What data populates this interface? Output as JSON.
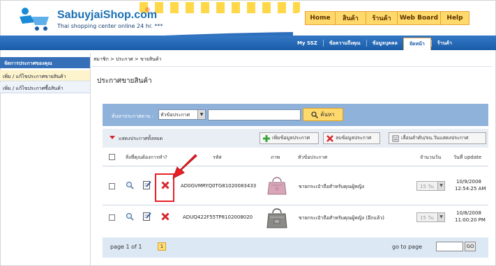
{
  "brand": {
    "name": "SabuyjaiShop.com",
    "reg": "®",
    "tagline": "Thai shopping center online 24 hr. ***"
  },
  "topnav": [
    {
      "label": "Home",
      "w": 43
    },
    {
      "label": "สินค้า",
      "w": 44
    },
    {
      "label": "ร้านค้า",
      "w": 45
    },
    {
      "label": "Web Board",
      "w": 62
    },
    {
      "label": "Help",
      "w": 40
    }
  ],
  "subnav": [
    {
      "label": "My SSZ",
      "active": false
    },
    {
      "label": "ข้อความถึงคุณ",
      "active": false
    },
    {
      "label": "ข้อมูลบุคคล",
      "active": false
    },
    {
      "label": "จัดหน้า",
      "active": true
    },
    {
      "label": "ร้านค้า",
      "active": false
    }
  ],
  "sidebar": {
    "title": "จัดการประกาศของคุณ",
    "items": [
      "เพิ่ม / แก้ไขประกาศขายสินค้า",
      "เพิ่ม / แก้ไขประกาศซื้อสินค้า"
    ]
  },
  "breadcrumb": "สมาชิก > ประกาศ > ขายสินค้า",
  "page_title": "ประกาศขายสินค้า",
  "search": {
    "label": "ค้นหาประกาศตาม :",
    "select_value": "หัวข้อประกาศ",
    "input_value": "",
    "button": "ค้นหา"
  },
  "toolbar": {
    "show_all": "แสดงประกาศทั้งหมด",
    "add": "เพิ่มข้อมูลประกาศ",
    "delete": "ลบข้อมูลประกาศ",
    "sort": "เลื่อนลำดับ/จน.วันแสดงประกาศ"
  },
  "table": {
    "headers": {
      "action": "สิ่งที่คุณต้องการทำ?",
      "code": "รหัส",
      "image": "ภาพ",
      "subject": "หัวข้อประกาศ",
      "days": "จำนวนวัน",
      "update": "วันที่ update"
    },
    "rows": [
      {
        "code": "AD0GVMRYQ0TG81020083433",
        "subject": "ขายกระเป๋าถือสำหรับคุณผู้หญิง",
        "days": "15 วัน",
        "date": "10/9/2008",
        "time": "12:54:25 AM"
      },
      {
        "code": "ADUQ422F55TP8102008020",
        "subject": "ขายกระเป๋าถือสำหรับคุณผู้หญิง (อีกแล้ว)",
        "days": "15 วัน",
        "date": "10/8/2008",
        "time": "11:00:20 PM"
      }
    ]
  },
  "pager": {
    "text": "page 1 of 1",
    "current": "1",
    "goto_label": "go to page",
    "goto_value": "",
    "go": "GO"
  },
  "colors": {
    "brand_blue": "#1a6fb5",
    "nav_yellow": "#ffd96b",
    "highlight_red": "#e82026"
  }
}
